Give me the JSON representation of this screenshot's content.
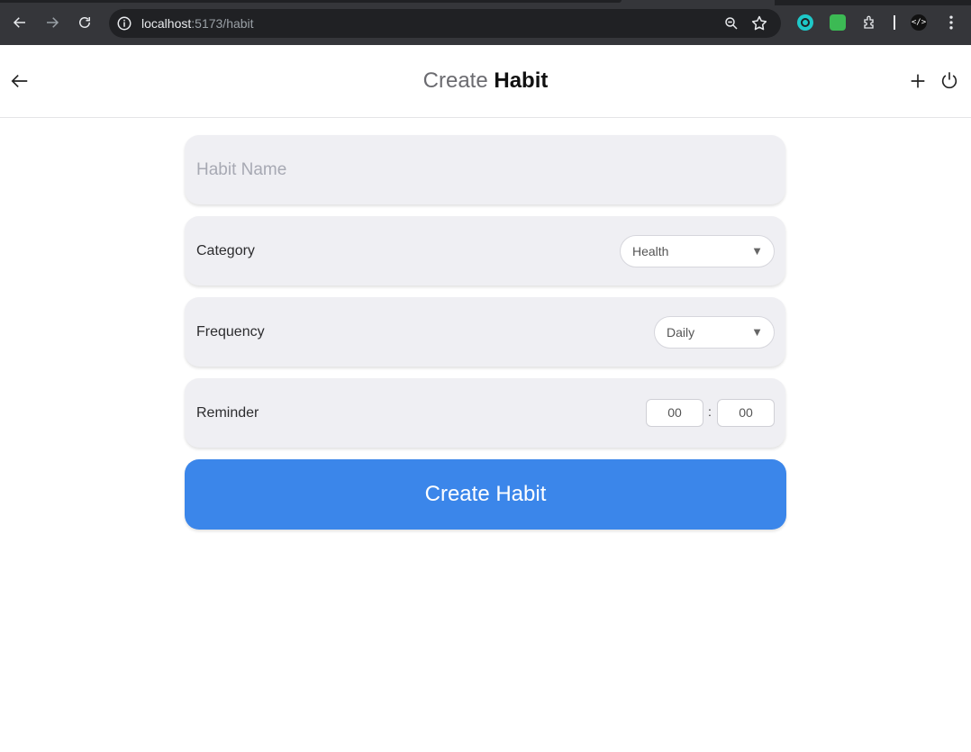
{
  "browser": {
    "url_host": "localhost",
    "url_path": ":5173/habit",
    "ext_devtools_label": "</>"
  },
  "header": {
    "title_part1": "Create",
    "title_part2": "Habit"
  },
  "form": {
    "name_placeholder": "Habit Name",
    "name_value": "",
    "category_label": "Category",
    "category_value": "Health",
    "frequency_label": "Frequency",
    "frequency_value": "Daily",
    "reminder_label": "Reminder",
    "reminder_hour": "00",
    "reminder_separator": ":",
    "reminder_minute": "00",
    "submit_label": "Create Habit"
  },
  "colors": {
    "primary": "#3b86ea",
    "card_bg": "#efeff3",
    "chrome_bg": "#35363a"
  },
  "icons": [
    "back-arrow-icon",
    "forward-arrow-icon",
    "reload-icon",
    "info-icon",
    "zoom-icon",
    "star-icon",
    "extension-icon",
    "kebab-menu-icon",
    "plus-icon",
    "power-icon",
    "caret-down-icon"
  ]
}
